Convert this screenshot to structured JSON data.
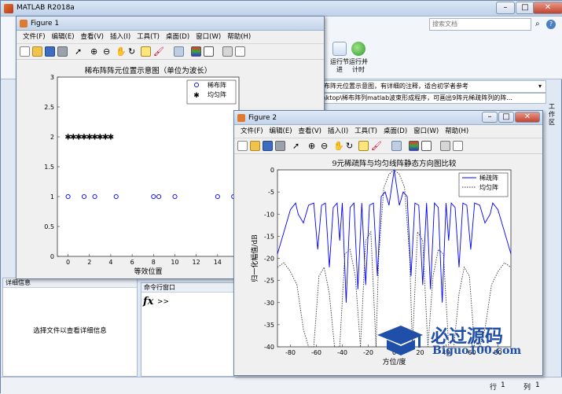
{
  "app": {
    "title": "MATLAB R2018a",
    "search_placeholder": "搜索文档",
    "ribbon": {
      "run_section": "运行节",
      "run_advance": "进",
      "run_and_time": "运行并\n计时"
    },
    "address_line1": "布阵元位置示意图，有详细的注释，适合初学者参考",
    "address_line2": "\\ktop\\稀布阵列matlab波束形成程序，可画出9阵元稀疏阵列的阵...",
    "side_tab": "工作区",
    "detail_panel": {
      "header": "详细信息",
      "message": "选择文件以查看详细信息"
    },
    "command_window": {
      "header": "命令行窗口",
      "fx": "fx",
      "prompt": ">>"
    },
    "status": {
      "line_label": "行",
      "line_value": "1",
      "col_label": "列",
      "col_value": "1"
    }
  },
  "figure1": {
    "title": "Figure 1",
    "menu": [
      "文件(F)",
      "编辑(E)",
      "查看(V)",
      "插入(I)",
      "工具(T)",
      "桌面(D)",
      "窗口(W)",
      "帮助(H)"
    ]
  },
  "figure2": {
    "title": "Figure 2",
    "menu": [
      "文件(F)",
      "编辑(E)",
      "查看(V)",
      "插入(I)",
      "工具(T)",
      "桌面(D)",
      "窗口(W)",
      "帮助(H)"
    ]
  },
  "watermark": {
    "name": "必过源码",
    "url": "Biguo100.com"
  },
  "chart_data": [
    {
      "type": "scatter",
      "title": "稀布阵阵元位置示意图（单位为波长）",
      "xlabel": "等效位置",
      "ylabel": "",
      "xlim": [
        -1,
        16
      ],
      "ylim": [
        0,
        3
      ],
      "xticks": [
        0,
        2,
        4,
        6,
        8,
        10,
        12,
        14
      ],
      "yticks": [
        0,
        0.5,
        1,
        1.5,
        2,
        2.5,
        3
      ],
      "legend_position": "top-right",
      "series": [
        {
          "name": "稀布阵",
          "marker": "circle",
          "color": "#0000ff",
          "x": [
            0,
            1.5,
            2.5,
            4.5,
            8,
            8.5,
            10,
            14,
            15.5
          ],
          "y": [
            1,
            1,
            1,
            1,
            1,
            1,
            1,
            1,
            1
          ]
        },
        {
          "name": "均匀阵",
          "marker": "star",
          "color": "#000000",
          "x": [
            0,
            0.5,
            1,
            1.5,
            2,
            2.5,
            3,
            3.5,
            4
          ],
          "y": [
            2,
            2,
            2,
            2,
            2,
            2,
            2,
            2,
            2
          ]
        }
      ]
    },
    {
      "type": "line",
      "title": "9元稀疏阵与均匀线阵静态方向图比较",
      "xlabel": "方位/度",
      "ylabel": "归一化幅值/dB",
      "xlim": [
        -90,
        90
      ],
      "ylim": [
        -40,
        0
      ],
      "xticks": [
        -80,
        -60,
        -40,
        -20,
        0,
        20,
        40,
        60,
        80
      ],
      "yticks": [
        0,
        -5,
        -10,
        -15,
        -20,
        -25,
        -30,
        -35,
        -40
      ],
      "legend_position": "top-right",
      "series": [
        {
          "name": "稀疏阵",
          "style": "solid",
          "color": "#0000ff",
          "x": [
            -90,
            -85,
            -80,
            -76,
            -74,
            -70,
            -66,
            -62,
            -59,
            -56,
            -53,
            -50,
            -47,
            -44,
            -42,
            -40,
            -37,
            -34,
            -31,
            -28,
            -25,
            -22,
            -19,
            -16,
            -13,
            -10,
            -7,
            -4,
            -2,
            0,
            2,
            4,
            7,
            10,
            13,
            16,
            19,
            22,
            25,
            28,
            31,
            34,
            37,
            40,
            42,
            44,
            47,
            50,
            53,
            56,
            59,
            62,
            66,
            70,
            74,
            76,
            80,
            85,
            90
          ],
          "y": [
            -19,
            -14,
            -9,
            -7.5,
            -10,
            -12,
            -8,
            -7.5,
            -18,
            -8,
            -7.5,
            -22,
            -8.5,
            -7.5,
            -16,
            -7.5,
            -30,
            -8.5,
            -7.5,
            -27,
            -7.5,
            -26,
            -8,
            -7.5,
            -24,
            -6,
            -5,
            -8,
            -4,
            0,
            -4,
            -8,
            -5,
            -6,
            -24,
            -7.5,
            -8,
            -26,
            -7.5,
            -27,
            -7.5,
            -8.5,
            -30,
            -7.5,
            -16,
            -7.5,
            -8.5,
            -22,
            -7.5,
            -8,
            -18,
            -7.5,
            -8,
            -12,
            -10,
            -7.5,
            -9,
            -14,
            -19
          ]
        },
        {
          "name": "均匀阵",
          "style": "dotted",
          "color": "#333333",
          "x": [
            -90,
            -85,
            -80,
            -75,
            -70,
            -66,
            -62,
            -58,
            -54,
            -50,
            -46,
            -42,
            -38,
            -34,
            -30,
            -26,
            -22,
            -18,
            -14,
            -12,
            -8,
            -4,
            0,
            4,
            8,
            12,
            14,
            18,
            22,
            26,
            30,
            34,
            38,
            42,
            46,
            50,
            54,
            58,
            62,
            66,
            70,
            75,
            80,
            85,
            90
          ],
          "y": [
            -22,
            -21,
            -23,
            -26,
            -36,
            -40,
            -40,
            -24,
            -22,
            -28,
            -40,
            -40,
            -19,
            -18,
            -24,
            -40,
            -16,
            -14,
            -40,
            -20,
            -4,
            -1,
            0,
            -1,
            -4,
            -20,
            -40,
            -14,
            -16,
            -40,
            -24,
            -18,
            -19,
            -40,
            -40,
            -28,
            -22,
            -24,
            -40,
            -40,
            -36,
            -26,
            -23,
            -21,
            -22
          ]
        }
      ]
    }
  ]
}
